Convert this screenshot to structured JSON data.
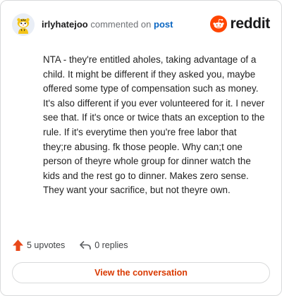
{
  "comment": {
    "username": "irlyhatejoo",
    "action_text": "commented on",
    "post_link_label": "post",
    "text": "NTA - they're entitled aholes, taking advantage of a child. It might be different if they asked you, maybe offered some type of compensation such as money. It's also different if you ever volunteered for it. I never see that. If it's once or twice thats an exception to the rule. If it's everytime then you're free labor that they;re abusing. fk those people. Why can;t one person of theyre whole group for dinner watch the kids and the rest go to dinner. Makes zero sense. They want your sacrifice, but not theyre own."
  },
  "brand": {
    "name": "reddit",
    "logo_icon": "reddit-snoo-icon",
    "color": "#ff4500"
  },
  "stats": {
    "upvotes_label": "5 upvotes",
    "upvote_icon": "upvote-arrow-icon",
    "upvote_color": "#e8481a",
    "replies_label": "0 replies",
    "reply_icon": "reply-arrow-icon"
  },
  "cta": {
    "label": "View the conversation",
    "color": "#d93900"
  },
  "colors": {
    "link": "#0a66c2",
    "border": "#d9dadb"
  }
}
